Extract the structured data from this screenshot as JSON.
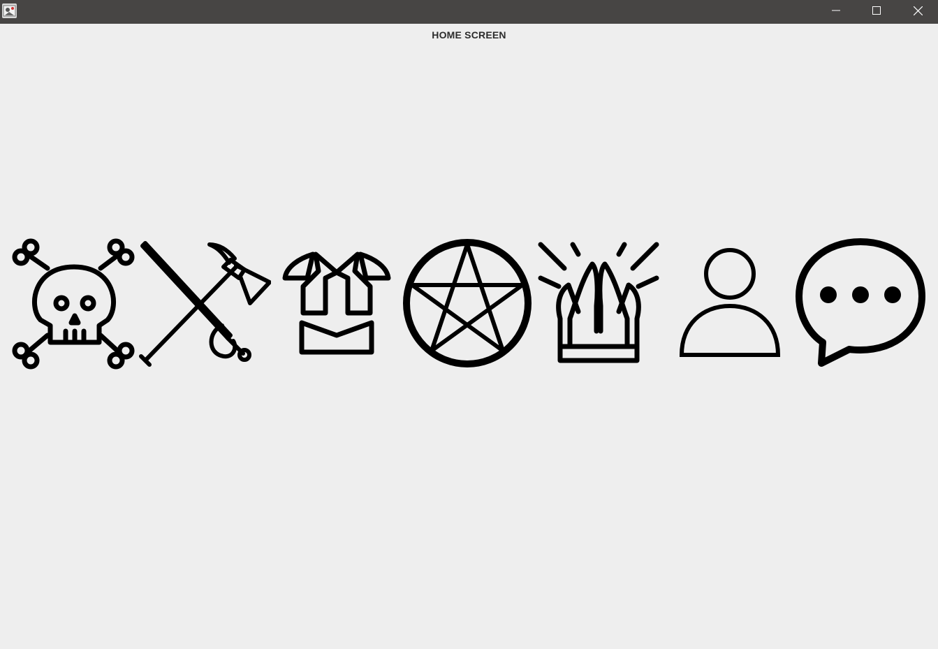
{
  "window": {
    "controls": [
      "minimize",
      "maximize",
      "close"
    ]
  },
  "screen": {
    "title": "HOME SCREEN"
  },
  "icons": [
    {
      "name": "skull-crossbones-icon"
    },
    {
      "name": "crossed-sword-axe-icon"
    },
    {
      "name": "armor-icon"
    },
    {
      "name": "pentagram-icon"
    },
    {
      "name": "praying-hands-icon"
    },
    {
      "name": "user-icon"
    },
    {
      "name": "chat-bubble-icon"
    }
  ],
  "colors": {
    "titlebar": "#474544",
    "background": "#eeeeee",
    "icon_stroke": "#000000"
  }
}
